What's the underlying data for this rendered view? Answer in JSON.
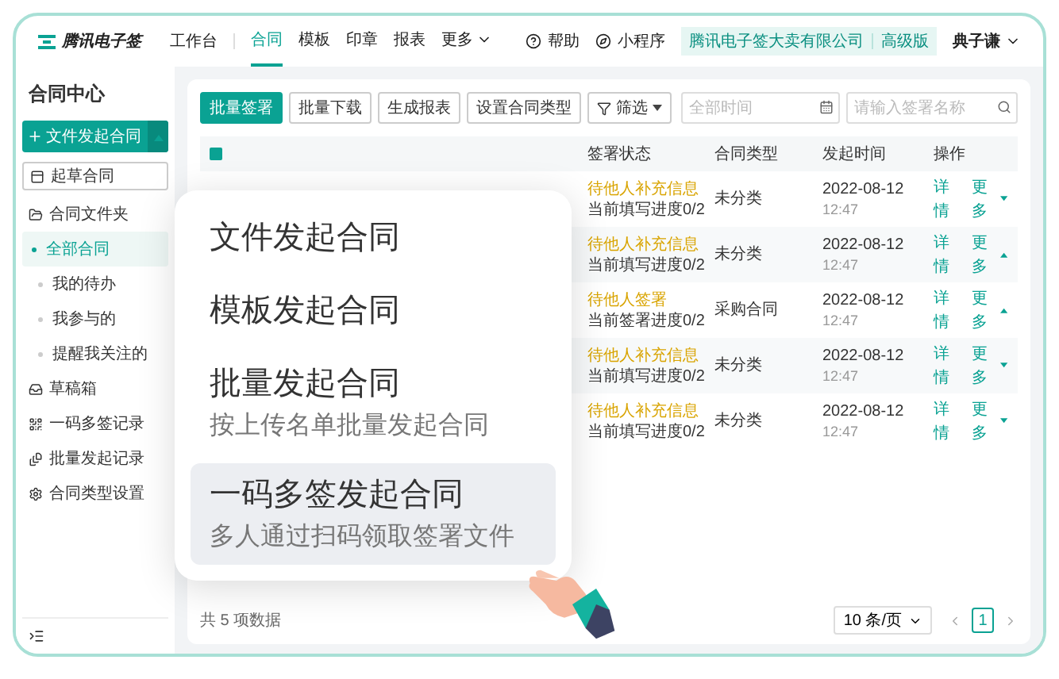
{
  "topbar": {
    "logo": "腾讯电子签",
    "workbench": "工作台",
    "tabs": [
      {
        "label": "合同",
        "selected": true
      },
      {
        "label": "模板",
        "selected": false
      },
      {
        "label": "印章",
        "selected": false
      },
      {
        "label": "报表",
        "selected": false
      },
      {
        "label": "更多",
        "selected": false
      }
    ],
    "help": "帮助",
    "mini_program": "小程序",
    "company": "腾讯电子签大卖有限公司",
    "plan_badge": "高级版",
    "user": "典子谦"
  },
  "sidebar": {
    "title": "合同中心",
    "primary_button": "文件发起合同",
    "draft_button": "起草合同",
    "items": [
      {
        "label": "合同文件夹",
        "selected": false,
        "children": [
          {
            "label": "全部合同",
            "selected": true
          },
          {
            "label": "我的待办",
            "selected": false
          },
          {
            "label": "我参与的",
            "selected": false
          },
          {
            "label": "提醒我关注的",
            "selected": false
          }
        ]
      },
      {
        "label": "草稿箱",
        "selected": false
      },
      {
        "label": "一码多签记录",
        "selected": false
      },
      {
        "label": "批量发起记录",
        "selected": false
      },
      {
        "label": "合同类型设置",
        "selected": false
      }
    ]
  },
  "toolbar": {
    "buttons": [
      {
        "label": "批量签署",
        "kind": "primary"
      },
      {
        "label": "批量下载",
        "kind": "plain"
      },
      {
        "label": "生成报表",
        "kind": "plain"
      },
      {
        "label": "设置合同类型",
        "kind": "plain"
      },
      {
        "label": "筛选",
        "kind": "filter"
      }
    ],
    "date_field": {
      "placeholder": "全部时间"
    },
    "search_field": {
      "placeholder": "请输入签署名称"
    }
  },
  "table": {
    "header_checked": true,
    "columns": [
      "签署状态",
      "合同类型",
      "发起时间",
      "操作"
    ],
    "rows": [
      {
        "status": "待他人补充信息",
        "progress": "当前填写进度0/2",
        "type": "未分类",
        "date": "2022-08-12",
        "time": "12:47",
        "detail": "详情",
        "more": "更多",
        "expanded": false
      },
      {
        "status": "待他人补充信息",
        "progress": "当前填写进度0/2",
        "type": "未分类",
        "date": "2022-08-12",
        "time": "12:47",
        "detail": "详情",
        "more": "更多",
        "expanded": true
      },
      {
        "status": "待他人签署",
        "progress": "当前签署进度0/2",
        "type": "采购合同",
        "date": "2022-08-12",
        "time": "12:47",
        "detail": "详情",
        "more": "更多",
        "expanded": true
      },
      {
        "status": "待他人补充信息",
        "progress": "当前填写进度0/2",
        "type": "未分类",
        "date": "2022-08-12",
        "time": "12:47",
        "detail": "详情",
        "more": "更多",
        "expanded": false
      },
      {
        "status": "待他人补充信息",
        "progress": "当前填写进度0/2",
        "type": "未分类",
        "date": "2022-08-12",
        "time": "12:47",
        "detail": "详情",
        "more": "更多",
        "expanded": false
      }
    ]
  },
  "footer": {
    "total": "共 5 项数据",
    "page_size": "10 条/页",
    "pages": [
      {
        "label": "1",
        "selected": true
      }
    ]
  },
  "popup_menu": {
    "items": [
      {
        "title": "文件发起合同",
        "selected": false
      },
      {
        "title": "模板发起合同",
        "selected": false
      },
      {
        "title": "批量发起合同",
        "description": "按上传名单批量发起合同",
        "selected": false
      },
      {
        "title": "一码多签发起合同",
        "description": "多人通过扫码领取签署文件",
        "selected": true
      }
    ]
  }
}
